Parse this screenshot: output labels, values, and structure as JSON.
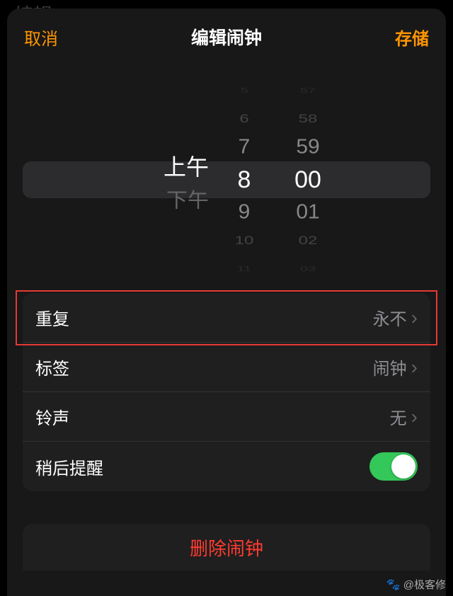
{
  "bg_hint": "编辑",
  "nav": {
    "cancel": "取消",
    "title": "编辑闹钟",
    "save": "存储"
  },
  "picker": {
    "ampm": {
      "options": [
        "上午",
        "下午"
      ],
      "selected": "上午"
    },
    "hour": {
      "faint_top": "5",
      "far_top": "6",
      "near_top": "7",
      "selected": "8",
      "near_bot": "9",
      "far_bot": "10",
      "faint_bot": "11"
    },
    "minute": {
      "faint_top": "57",
      "far_top": "58",
      "near_top": "59",
      "selected": "00",
      "near_bot": "01",
      "far_bot": "02",
      "faint_bot": "03"
    }
  },
  "settings": {
    "repeat": {
      "label": "重复",
      "value": "永不"
    },
    "tag": {
      "label": "标签",
      "value": "闹钟"
    },
    "sound": {
      "label": "铃声",
      "value": "无"
    },
    "snooze": {
      "label": "稍后提醒",
      "on": true
    }
  },
  "delete_label": "删除闹钟",
  "watermark": "@极客修"
}
